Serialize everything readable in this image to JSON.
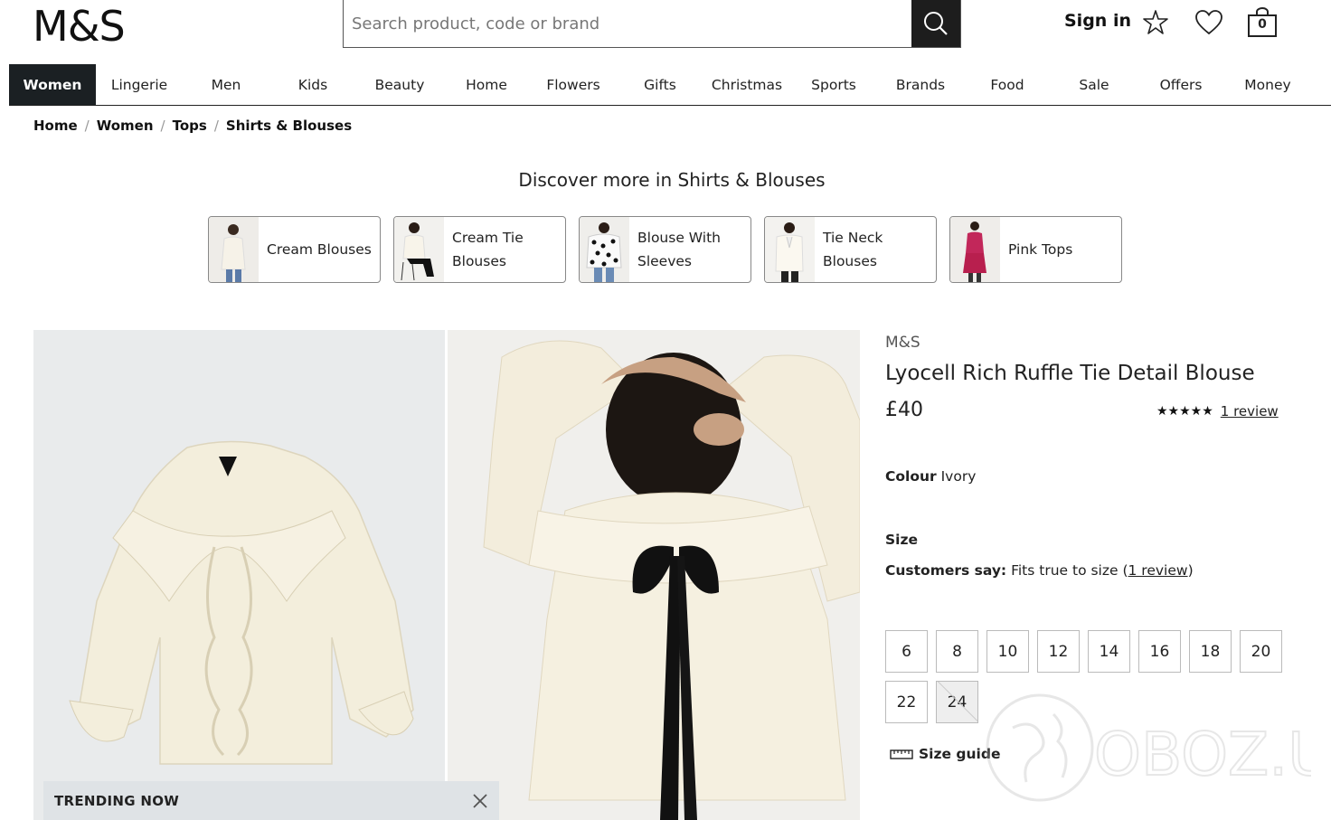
{
  "header": {
    "logo": "M&S",
    "search_placeholder": "Search product, code or brand",
    "sign_in": "Sign in",
    "bag_count": "0"
  },
  "nav": {
    "items": [
      "Women",
      "Lingerie",
      "Men",
      "Kids",
      "Beauty",
      "Home",
      "Flowers",
      "Gifts",
      "Christmas",
      "Sports",
      "Brands",
      "Food",
      "Sale",
      "Offers",
      "Money"
    ],
    "active": "Women"
  },
  "breadcrumb": [
    "Home",
    "Women",
    "Tops",
    "Shirts & Blouses"
  ],
  "discover": {
    "title": "Discover more in Shirts & Blouses",
    "cards": [
      {
        "line1": "Cream Blouses",
        "line2": ""
      },
      {
        "line1": "Cream Tie",
        "line2": "Blouses"
      },
      {
        "line1": "Blouse With",
        "line2": "Sleeves"
      },
      {
        "line1": "Tie Neck",
        "line2": "Blouses"
      },
      {
        "line1": "Pink Tops",
        "line2": ""
      }
    ]
  },
  "trending": {
    "label": "TRENDING NOW"
  },
  "product": {
    "brand": "M&S",
    "title": "Lyocell Rich Ruffle Tie Detail Blouse",
    "price": "£40",
    "rating_value": 5,
    "review_link": "1 review",
    "colour_label": "Colour",
    "colour_value": "Ivory",
    "size_label": "Size",
    "customers_say_label": "Customers say:",
    "customers_say_value": "Fits true to size",
    "customers_say_link": "1 review",
    "sizes": [
      "6",
      "8",
      "10",
      "12",
      "14",
      "16",
      "18",
      "20",
      "22",
      "24"
    ],
    "out_of_stock": [
      "24"
    ],
    "size_guide": "Size guide"
  },
  "watermark": {
    "text": "OBOZ.UA"
  },
  "colors": {
    "nav_active_bg": "#1b2023",
    "search_btn": "#1d1d1d",
    "trend_bg": "#dfe3e6"
  }
}
